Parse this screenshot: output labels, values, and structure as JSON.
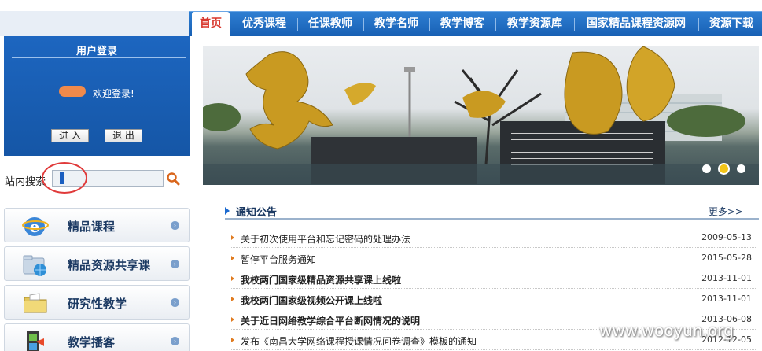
{
  "nav": {
    "items": [
      {
        "label": "首页",
        "active": true
      },
      {
        "label": "优秀课程"
      },
      {
        "label": "任课教师"
      },
      {
        "label": "教学名师"
      },
      {
        "label": "教学博客"
      },
      {
        "label": "教学资源库"
      },
      {
        "label": "国家精品课程资源网"
      },
      {
        "label": "资源下载"
      }
    ]
  },
  "login": {
    "title": "用户登录",
    "welcome": "欢迎登录!",
    "enter_label": "进 入",
    "logout_label": "退 出"
  },
  "search": {
    "label": "站内搜索",
    "value": "",
    "icon": "search-icon"
  },
  "side_menu": [
    {
      "label": "精品课程",
      "icon": "ie-icon"
    },
    {
      "label": "精品资源共享课",
      "icon": "globe-folder-icon"
    },
    {
      "label": "研究性教学",
      "icon": "folder-icon"
    },
    {
      "label": "教学播客",
      "icon": "film-icon"
    }
  ],
  "notices": {
    "title": "通知公告",
    "more": "更多>>",
    "items": [
      {
        "title": "关于初次使用平台和忘记密码的处理办法",
        "date": "2009-05-13",
        "bold": false
      },
      {
        "title": "暂停平台服务通知",
        "date": "2015-05-28",
        "bold": false
      },
      {
        "title": "我校两门国家级精品资源共享课上线啦",
        "date": "2013-11-01",
        "bold": true
      },
      {
        "title": "我校两门国家级视频公开课上线啦",
        "date": "2013-11-01",
        "bold": true
      },
      {
        "title": "关于近日网络教学综合平台断网情况的说明",
        "date": "2013-06-08",
        "bold": true
      },
      {
        "title": "发布《南昌大学网络课程授课情况问卷调查》模板的通知",
        "date": "2012-12-05",
        "bold": false
      }
    ]
  },
  "banner": {
    "active_slide": 2,
    "slide_count": 3
  },
  "watermark": "www.wooyun.org",
  "colors": {
    "nav_blue": "#1f6cc4",
    "login_blue": "#1a5fb4",
    "accent_red": "#d8382e",
    "gold": "#c79a1e"
  }
}
